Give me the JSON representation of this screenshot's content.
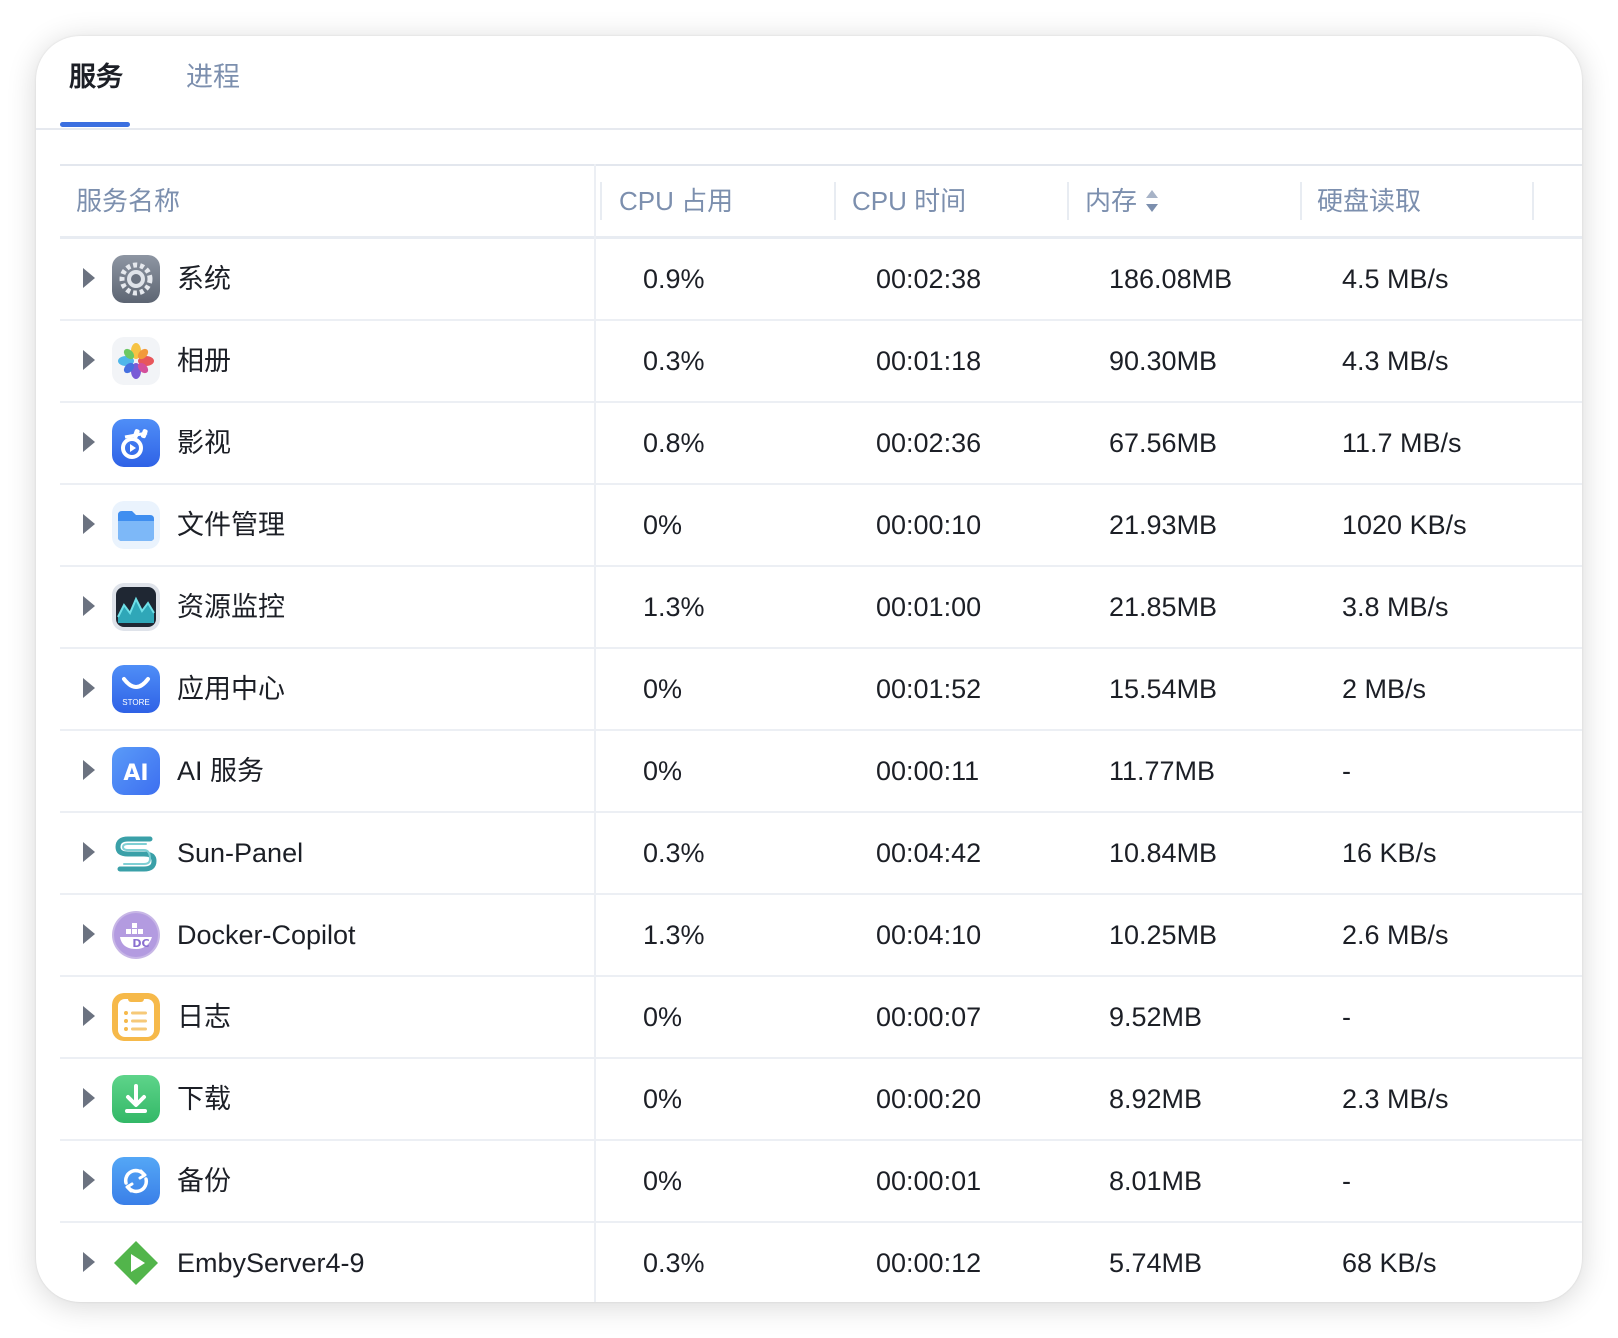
{
  "tabs": [
    {
      "label": "服务",
      "active": true
    },
    {
      "label": "进程",
      "active": false
    }
  ],
  "table": {
    "columns": {
      "name": "服务名称",
      "cpu": "CPU 占用",
      "cpu_time": "CPU 时间",
      "memory": "内存",
      "disk_read": "硬盘读取"
    },
    "sorted_column": "memory",
    "rows": [
      {
        "icon": "settings-gear-icon",
        "name": "系统",
        "cpu": "0.9%",
        "cpu_time": "00:02:38",
        "memory": "186.08MB",
        "disk_read": "4.5 MB/s"
      },
      {
        "icon": "photos-pinwheel-icon",
        "name": "相册",
        "cpu": "0.3%",
        "cpu_time": "00:01:18",
        "memory": "90.30MB",
        "disk_read": "4.3 MB/s"
      },
      {
        "icon": "video-play-icon",
        "name": "影视",
        "cpu": "0.8%",
        "cpu_time": "00:02:36",
        "memory": "67.56MB",
        "disk_read": "11.7 MB/s"
      },
      {
        "icon": "folder-icon",
        "name": "文件管理",
        "cpu": "0%",
        "cpu_time": "00:00:10",
        "memory": "21.93MB",
        "disk_read": "1020 KB/s"
      },
      {
        "icon": "activity-monitor-icon",
        "name": "资源监控",
        "cpu": "1.3%",
        "cpu_time": "00:01:00",
        "memory": "21.85MB",
        "disk_read": "3.8 MB/s"
      },
      {
        "icon": "app-store-icon",
        "name": "应用中心",
        "icon_text": "STORE",
        "cpu": "0%",
        "cpu_time": "00:01:52",
        "memory": "15.54MB",
        "disk_read": "2 MB/s"
      },
      {
        "icon": "ai-service-icon",
        "name": "AI 服务",
        "icon_text": "AI",
        "cpu": "0%",
        "cpu_time": "00:00:11",
        "memory": "11.77MB",
        "disk_read": "-"
      },
      {
        "icon": "sun-panel-icon",
        "name": "Sun-Panel",
        "cpu": "0.3%",
        "cpu_time": "00:04:42",
        "memory": "10.84MB",
        "disk_read": "16 KB/s"
      },
      {
        "icon": "docker-whale-icon",
        "name": "Docker-Copilot",
        "icon_text": "DC",
        "cpu": "1.3%",
        "cpu_time": "00:04:10",
        "memory": "10.25MB",
        "disk_read": "2.6 MB/s"
      },
      {
        "icon": "log-notes-icon",
        "name": "日志",
        "cpu": "0%",
        "cpu_time": "00:00:07",
        "memory": "9.52MB",
        "disk_read": "-"
      },
      {
        "icon": "download-arrow-icon",
        "name": "下载",
        "cpu": "0%",
        "cpu_time": "00:00:20",
        "memory": "8.92MB",
        "disk_read": "2.3 MB/s"
      },
      {
        "icon": "backup-sync-icon",
        "name": "备份",
        "cpu": "0%",
        "cpu_time": "00:00:01",
        "memory": "8.01MB",
        "disk_read": "-"
      },
      {
        "icon": "emby-play-icon",
        "name": "EmbyServer4-9",
        "cpu": "0.3%",
        "cpu_time": "00:00:12",
        "memory": "5.74MB",
        "disk_read": "68 KB/s"
      }
    ]
  },
  "colors": {
    "accent": "#3b6fe0",
    "header_text": "#7c8fae",
    "body_text": "#1c1f26"
  }
}
